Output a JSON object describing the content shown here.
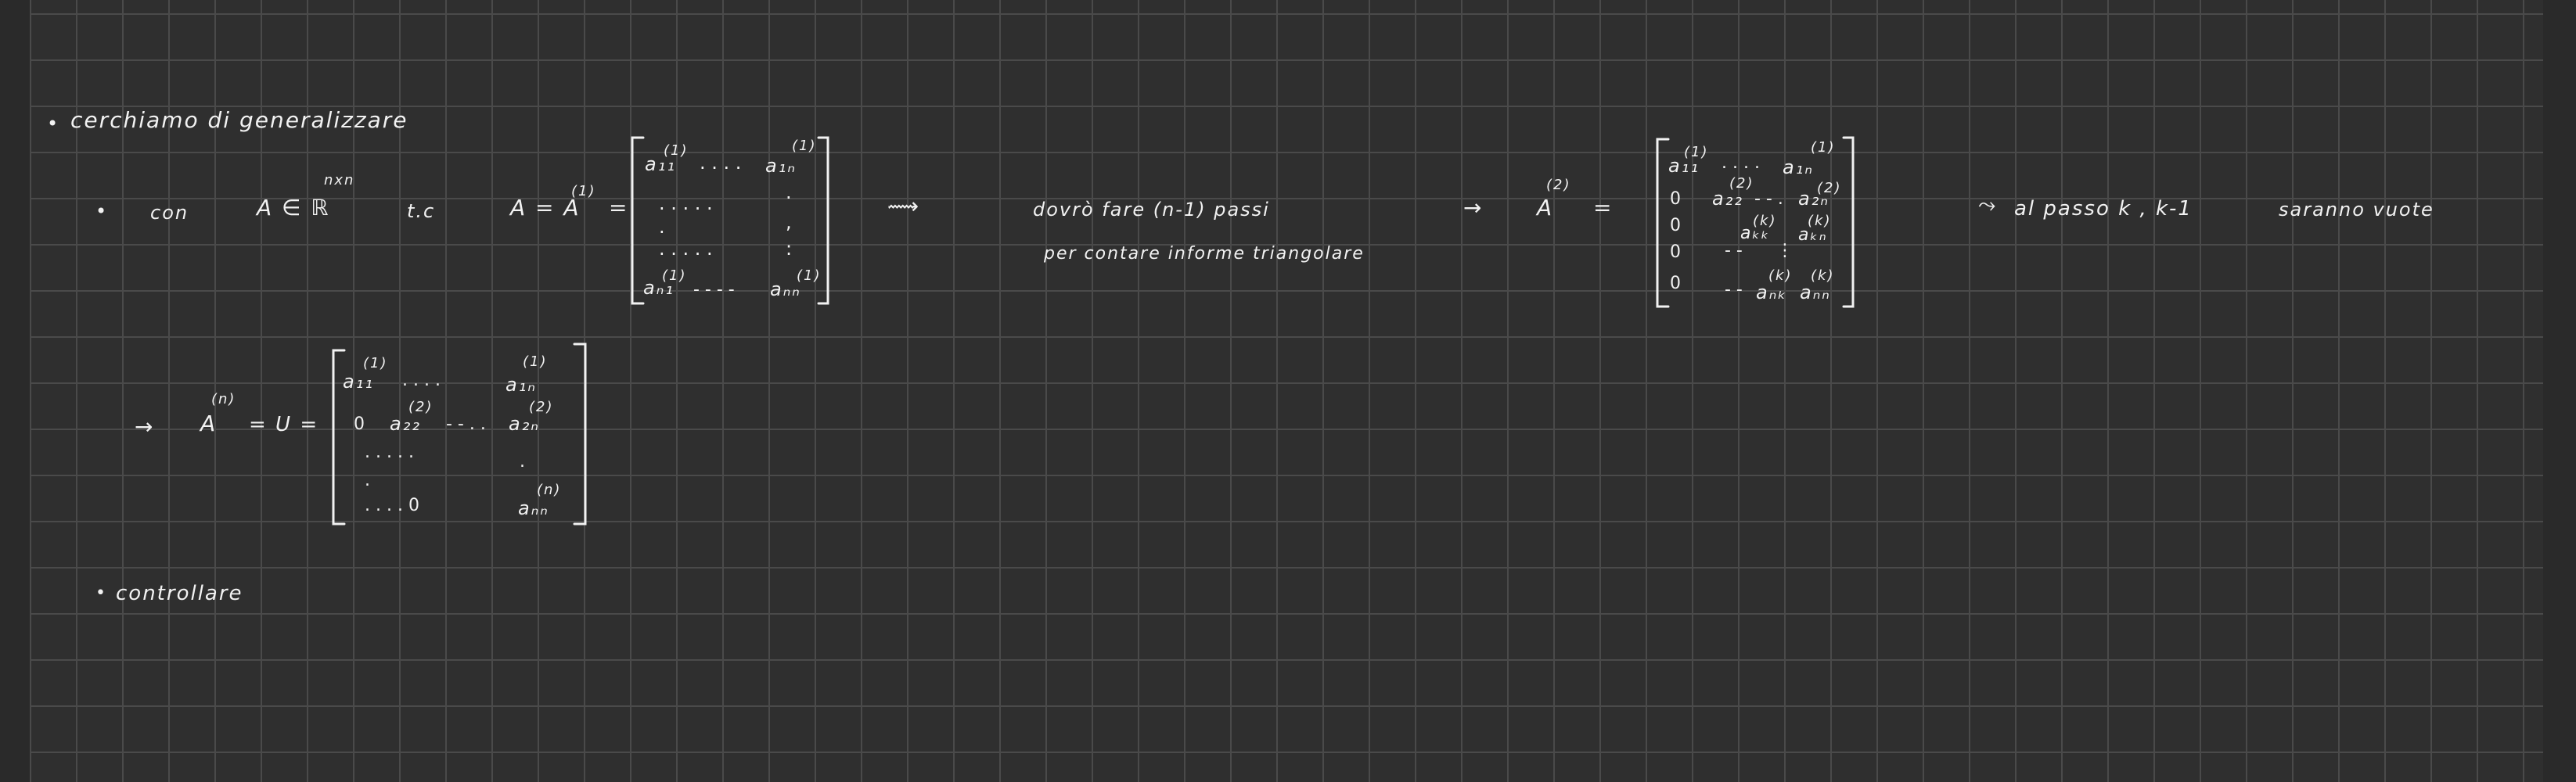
{
  "notes": {
    "line1": {
      "bullet": "•",
      "text": "cerchiamo di generalizzare"
    },
    "line2": {
      "bullet": "•",
      "con": "con",
      "a_in": "A ∈ ℝ",
      "nxn": "nxn",
      "tc": "t.c",
      "a_eq": "A = A",
      "a_sup": "(1)",
      "eq": "=",
      "matrix1": {
        "r1c1": "a₁₁",
        "r1c1_sup": "(1)",
        "r1dots": ". .   . .",
        "r1cn": "a₁ₙ",
        "r1cn_sup": "(1)",
        "r2": ".    .  .  .  .",
        "r2end": ".",
        "r3": ".",
        "r3end": ",",
        "r4": ".   .  .  .  .",
        "r4end": ":",
        "rnc1": "aₙ₁",
        "rnc1_sup": "(1)",
        "rndots": "- - - -",
        "rncn": "aₙₙ",
        "rncn_sup": "(1)"
      },
      "arrow1": "⟿",
      "dovro": "dovrò fare (n-1) passi",
      "per_contare": "per contare informe triangolare",
      "arrow2": "→",
      "a2": "A",
      "a2_sup": "(2)",
      "eq2": "=",
      "matrix2": {
        "r1c1": "a₁₁",
        "r1c1_sup": "(1)",
        "r1dots": ". .  . .",
        "r1cn": "a₁ₙ",
        "r1cn_sup": "(1)",
        "r2c1": "0",
        "r2c2": "a₂₂",
        "r2c2_sup": "(2)",
        "r2dots": "- - .",
        "r2cn": "a₂ₙ",
        "r2cn_sup": "(2)",
        "r3c1": "0",
        "r3kk": "aₖₖ",
        "r3kk_sup": "(k)",
        "r3kn": "aₖₙ",
        "r3kn_sup": "(k)",
        "r4c1": "0",
        "r4dash": "- -",
        "r4dots": "⋮",
        "r5c1": "0",
        "r5dash": "- -",
        "r5nk": "aₙₖ",
        "r5nk_sup": "(k)",
        "r5nn": "aₙₙ",
        "r5nn_sup": "(k)"
      },
      "tilde_arrow": "⤳",
      "al_passo": "al passo k , k-1",
      "saranno": "saranno vuote"
    },
    "line3": {
      "arrow": "→",
      "an": "A",
      "an_sup": "(n)",
      "eq_u": "= U =",
      "matrix3": {
        "r1c1": "a₁₁",
        "r1c1_sup": "(1)",
        "r1dots": ". . .  .",
        "r1cn": "a₁ₙ",
        "r1cn_sup": "(1)",
        "r2c1": "0",
        "r2c2": "a₂₂",
        "r2c2_sup": "(2)",
        "r2dots": "- - . .",
        "r2cn": "a₂ₙ",
        "r2cn_sup": "(2)",
        "r3": ".    .   .      .   .",
        "r3end": ".",
        "r4": ".",
        "r5": ".      .      .   .  0",
        "r5nn": "aₙₙ",
        "r5nn_sup": "(n)"
      }
    },
    "line4": {
      "bullet": "•",
      "text": "controllare"
    }
  }
}
